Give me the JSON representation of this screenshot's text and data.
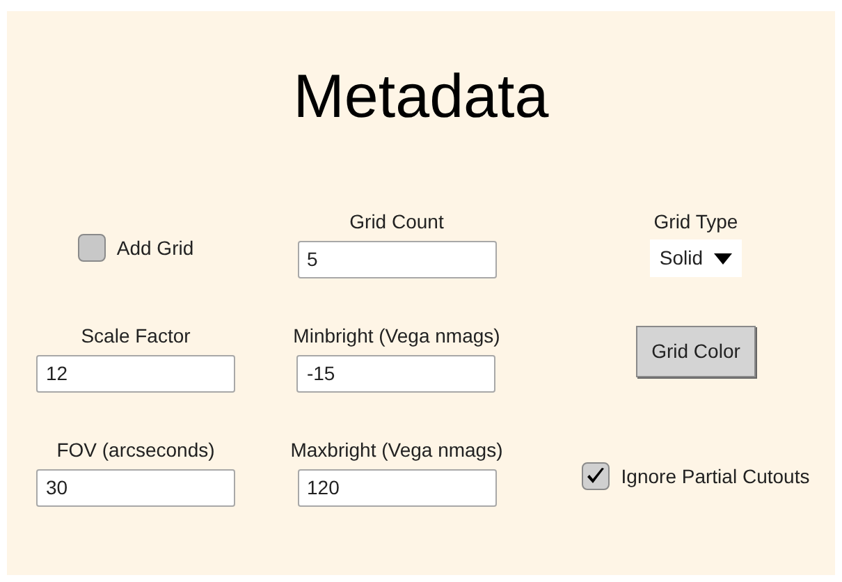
{
  "title": "Metadata",
  "rows": [
    [
      {
        "kind": "checkbox",
        "label": "Add Grid",
        "checked": false
      },
      {
        "kind": "field",
        "label": "Grid Count",
        "value": "5"
      },
      {
        "kind": "dropdown",
        "label": "Grid Type",
        "value": "Solid"
      }
    ],
    [
      {
        "kind": "field",
        "label": "Scale Factor",
        "value": "12"
      },
      {
        "kind": "field",
        "label": "Minbright (Vega nmags)",
        "value": "-15"
      },
      {
        "kind": "button",
        "label": "Grid Color"
      }
    ],
    [
      {
        "kind": "field",
        "label": "FOV (arcseconds)",
        "value": "30"
      },
      {
        "kind": "field",
        "label": "Maxbright (Vega nmags)",
        "value": "120"
      },
      {
        "kind": "checkbox",
        "label": "Ignore Partial Cutouts",
        "checked": true
      }
    ]
  ]
}
